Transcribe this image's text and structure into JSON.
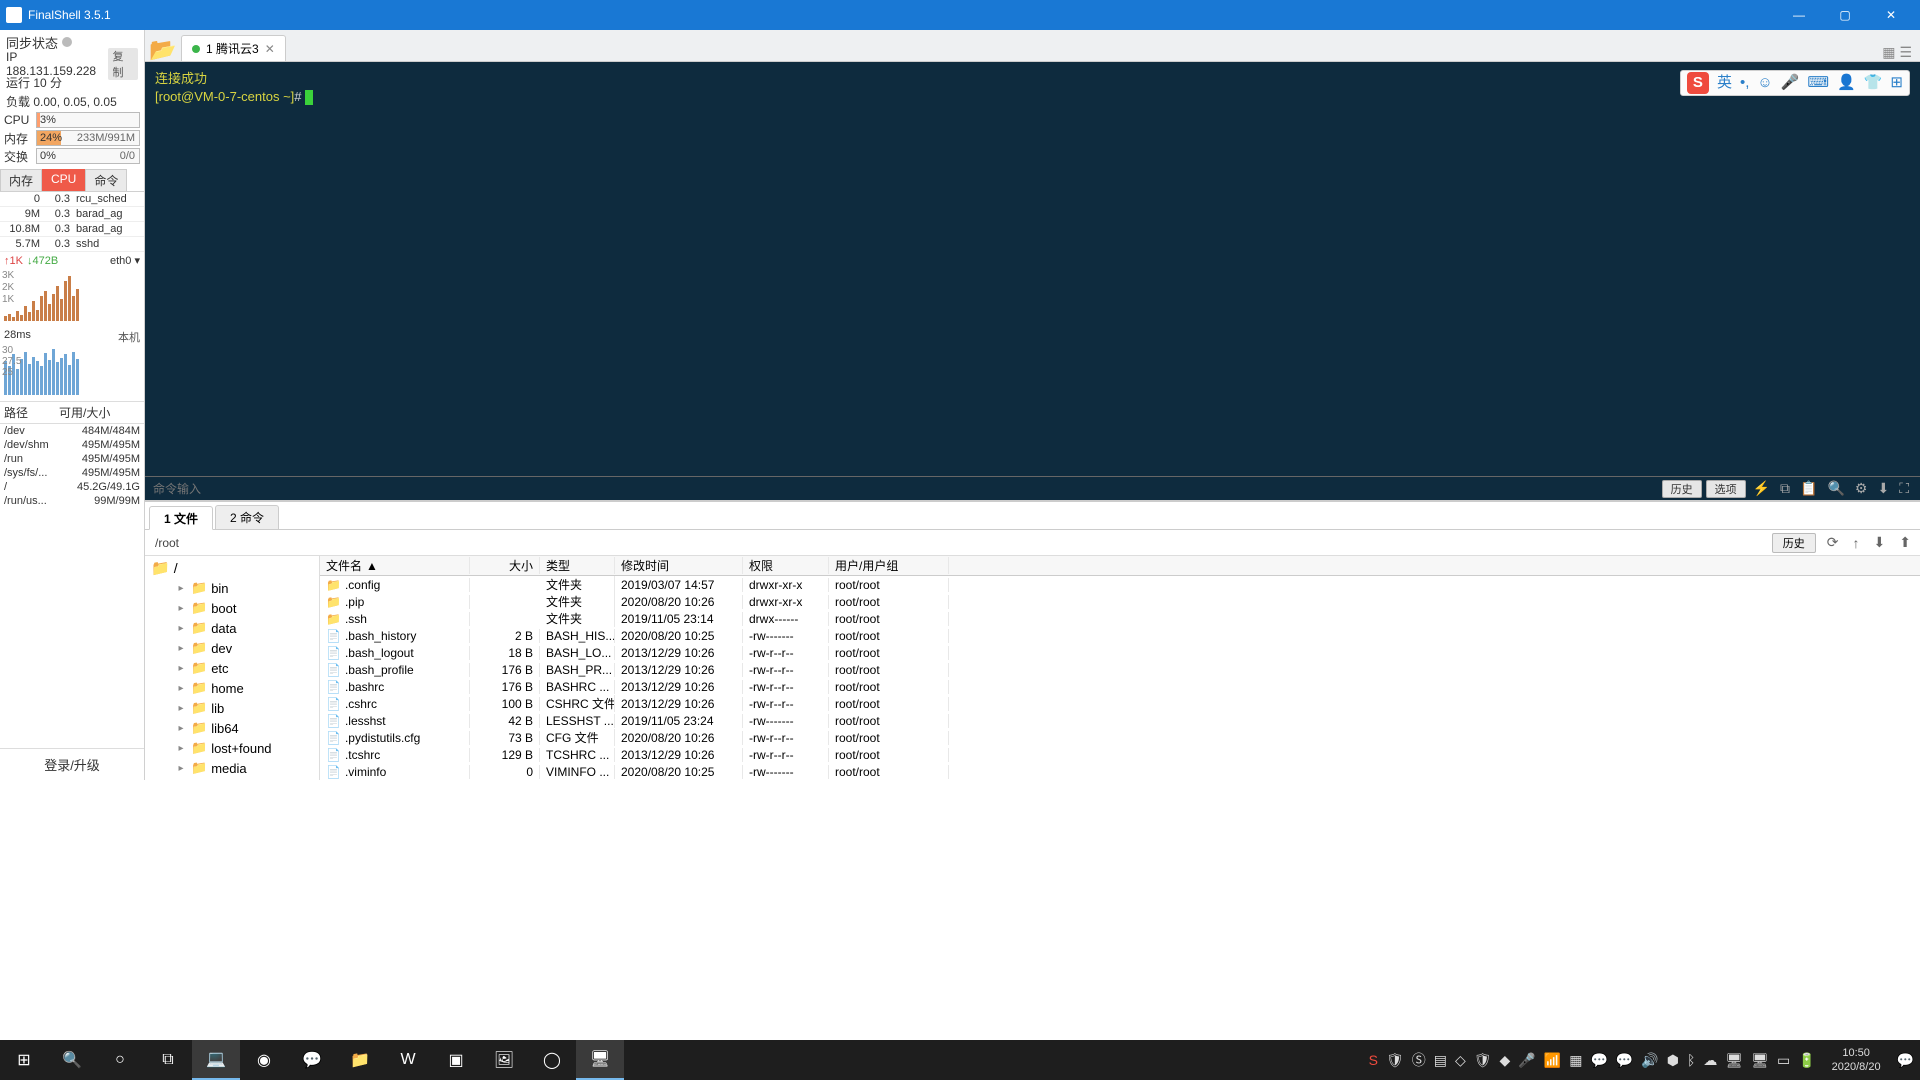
{
  "title": "FinalShell 3.5.1",
  "win": {
    "min": "—",
    "max": "▢",
    "close": "✕"
  },
  "left": {
    "sync": "同步状态",
    "ip": "IP 188.131.159.228",
    "copy": "复制",
    "uptime": "运行 10 分",
    "load": "负载 0.00, 0.05, 0.05",
    "cpu": {
      "label": "CPU",
      "pct": "3%",
      "fill": 3
    },
    "mem": {
      "label": "内存",
      "pct": "24%",
      "detail": "233M/991M",
      "fill": 24
    },
    "swap": {
      "label": "交换",
      "pct": "0%",
      "detail": "0/0",
      "fill": 0
    },
    "tabs": [
      "内存",
      "CPU",
      "命令"
    ],
    "procs": [
      {
        "c1": "0",
        "c2": "0.3",
        "c3": "rcu_sched"
      },
      {
        "c1": "9M",
        "c2": "0.3",
        "c3": "barad_ag"
      },
      {
        "c1": "10.8M",
        "c2": "0.3",
        "c3": "barad_ag"
      },
      {
        "c1": "5.7M",
        "c2": "0.3",
        "c3": "sshd"
      }
    ],
    "net": {
      "up": "↑1K",
      "dn": "↓472B",
      "if": "eth0 ▾",
      "yax": [
        "3K",
        "2K",
        "1K"
      ]
    },
    "ping": {
      "val": "28ms",
      "r": "本机",
      "yax": [
        "30",
        "27.5",
        "25"
      ]
    },
    "disk": {
      "h1": "路径",
      "h2": "可用/大小",
      "rows": [
        {
          "p": "/dev",
          "s": "484M/484M"
        },
        {
          "p": "/dev/shm",
          "s": "495M/495M"
        },
        {
          "p": "/run",
          "s": "495M/495M"
        },
        {
          "p": "/sys/fs/...",
          "s": "495M/495M"
        },
        {
          "p": "/",
          "s": "45.2G/49.1G"
        },
        {
          "p": "/run/us...",
          "s": "99M/99M"
        }
      ]
    },
    "login": "登录/升级"
  },
  "tab": {
    "label": "1 腾讯云3"
  },
  "term": {
    "l1": "连接成功",
    "l2a": "[root@VM-0-7-centos ~]",
    "l2b": "#"
  },
  "cmd": {
    "ph": "命令输入",
    "hist": "历史",
    "opts": "选项"
  },
  "ftabs": {
    "t1": "1 文件",
    "t2": "2 命令"
  },
  "path": "/root",
  "pathhist": "历史",
  "tree": {
    "root": "/",
    "items": [
      "bin",
      "boot",
      "data",
      "dev",
      "etc",
      "home",
      "lib",
      "lib64",
      "lost+found",
      "media"
    ]
  },
  "cols": {
    "name": "文件名",
    "size": "大小",
    "type": "类型",
    "mtime": "修改时间",
    "perm": "权限",
    "user": "用户/用户组"
  },
  "files": [
    {
      "ico": "d",
      "name": ".config",
      "size": "",
      "type": "文件夹",
      "mtime": "2019/03/07 14:57",
      "perm": "drwxr-xr-x",
      "user": "root/root"
    },
    {
      "ico": "d",
      "name": ".pip",
      "size": "",
      "type": "文件夹",
      "mtime": "2020/08/20 10:26",
      "perm": "drwxr-xr-x",
      "user": "root/root"
    },
    {
      "ico": "d",
      "name": ".ssh",
      "size": "",
      "type": "文件夹",
      "mtime": "2019/11/05 23:14",
      "perm": "drwx------",
      "user": "root/root"
    },
    {
      "ico": "f",
      "name": ".bash_history",
      "size": "2 B",
      "type": "BASH_HIS...",
      "mtime": "2020/08/20 10:25",
      "perm": "-rw-------",
      "user": "root/root"
    },
    {
      "ico": "f",
      "name": ".bash_logout",
      "size": "18 B",
      "type": "BASH_LO...",
      "mtime": "2013/12/29 10:26",
      "perm": "-rw-r--r--",
      "user": "root/root"
    },
    {
      "ico": "f",
      "name": ".bash_profile",
      "size": "176 B",
      "type": "BASH_PR...",
      "mtime": "2013/12/29 10:26",
      "perm": "-rw-r--r--",
      "user": "root/root"
    },
    {
      "ico": "f",
      "name": ".bashrc",
      "size": "176 B",
      "type": "BASHRC ...",
      "mtime": "2013/12/29 10:26",
      "perm": "-rw-r--r--",
      "user": "root/root"
    },
    {
      "ico": "f",
      "name": ".cshrc",
      "size": "100 B",
      "type": "CSHRC 文件",
      "mtime": "2013/12/29 10:26",
      "perm": "-rw-r--r--",
      "user": "root/root"
    },
    {
      "ico": "f",
      "name": ".lesshst",
      "size": "42 B",
      "type": "LESSHST ...",
      "mtime": "2019/11/05 23:24",
      "perm": "-rw-------",
      "user": "root/root"
    },
    {
      "ico": "f",
      "name": ".pydistutils.cfg",
      "size": "73 B",
      "type": "CFG 文件",
      "mtime": "2020/08/20 10:26",
      "perm": "-rw-r--r--",
      "user": "root/root"
    },
    {
      "ico": "f",
      "name": ".tcshrc",
      "size": "129 B",
      "type": "TCSHRC ...",
      "mtime": "2013/12/29 10:26",
      "perm": "-rw-r--r--",
      "user": "root/root"
    },
    {
      "ico": "f",
      "name": ".viminfo",
      "size": "0",
      "type": "VIMINFO ...",
      "mtime": "2020/08/20 10:25",
      "perm": "-rw-------",
      "user": "root/root"
    }
  ],
  "clock": {
    "time": "10:50",
    "date": "2020/8/20"
  }
}
